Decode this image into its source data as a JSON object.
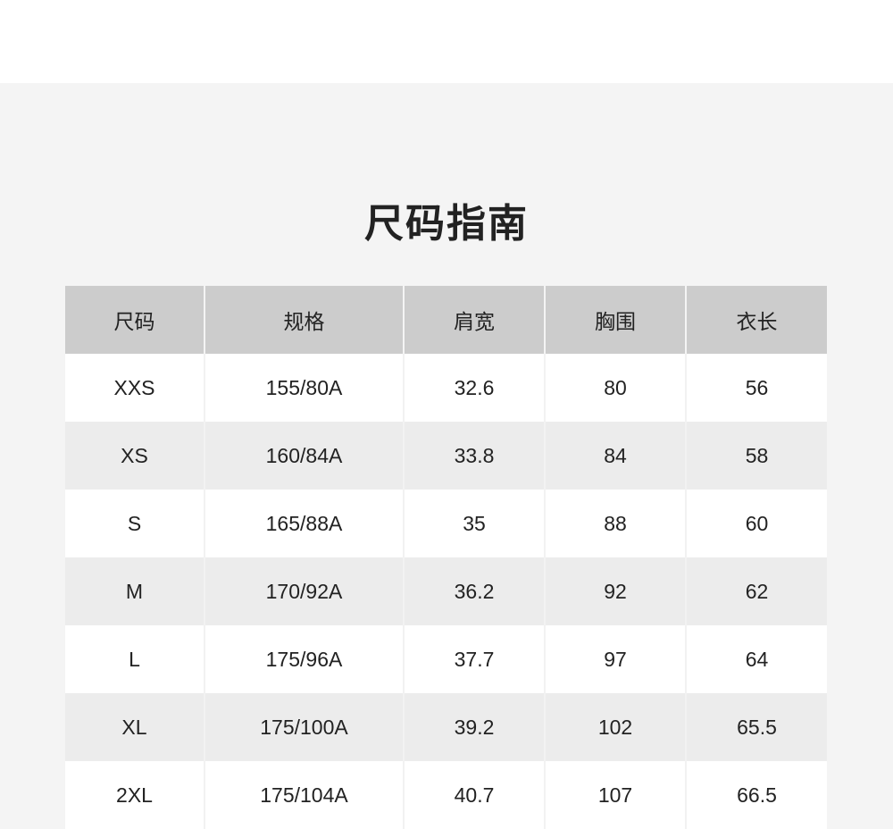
{
  "page": {
    "title": "尺码指南"
  },
  "table": {
    "headers": [
      "尺码",
      "规格",
      "肩宽",
      "胸围",
      "衣长"
    ],
    "rows": [
      [
        "XXS",
        "155/80A",
        "32.6",
        "80",
        "56"
      ],
      [
        "XS",
        "160/84A",
        "33.8",
        "84",
        "58"
      ],
      [
        "S",
        "165/88A",
        "35",
        "88",
        "60"
      ],
      [
        "M",
        "170/92A",
        "36.2",
        "92",
        "62"
      ],
      [
        "L",
        "175/96A",
        "37.7",
        "97",
        "64"
      ],
      [
        "XL",
        "175/100A",
        "39.2",
        "102",
        "65.5"
      ],
      [
        "2XL",
        "175/104A",
        "40.7",
        "107",
        "66.5"
      ]
    ]
  },
  "colors": {
    "panel_background": "#f4f4f4",
    "header_background": "#cccccc",
    "row_white": "#ffffff",
    "row_gray": "#ececec",
    "text": "#222222"
  }
}
